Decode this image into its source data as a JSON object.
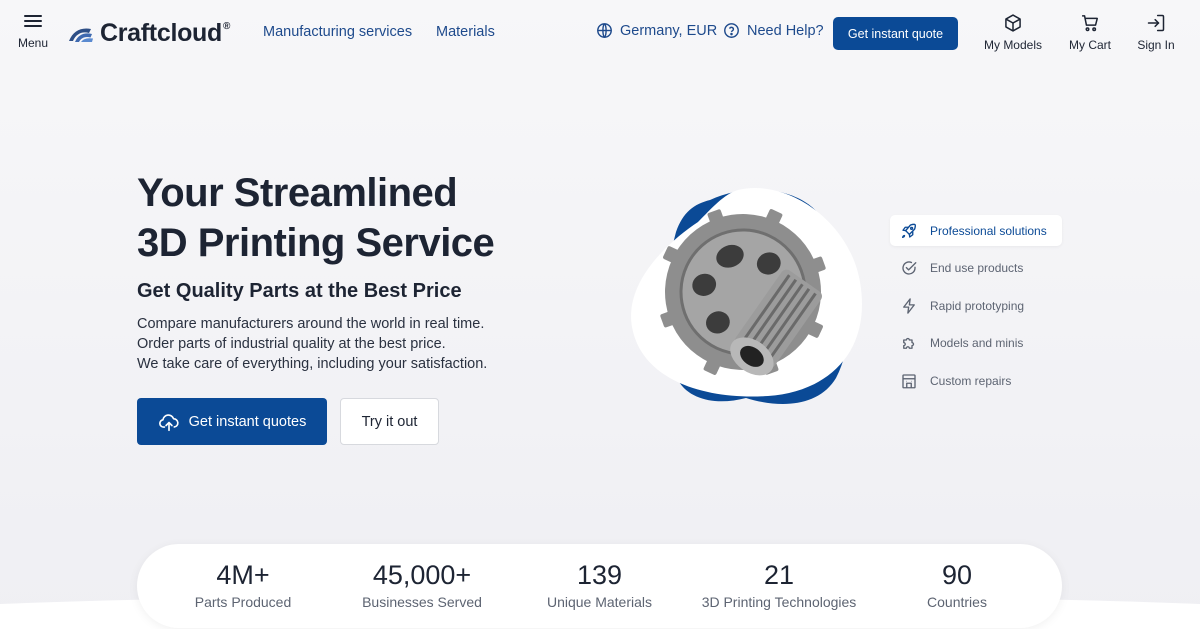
{
  "header": {
    "menu_label": "Menu",
    "logo_text": "Craftcloud",
    "logo_reg": "®",
    "nav": {
      "manufacturing": "Manufacturing services",
      "materials": "Materials"
    },
    "locale": "Germany, EUR",
    "help": "Need Help?",
    "quote_button": "Get instant quote",
    "my_models": "My Models",
    "my_cart": "My Cart",
    "sign_in": "Sign In"
  },
  "hero": {
    "title_line1": "Your Streamlined",
    "title_line2": "3D Printing Service",
    "subtitle": "Get Quality Parts at the Best Price",
    "desc_line1": "Compare manufacturers around the world in real time.",
    "desc_line2": "Order parts of industrial quality at the best price.",
    "desc_line3": "We take care of everything, including your satisfaction.",
    "primary_button": "Get instant quotes",
    "secondary_button": "Try it out"
  },
  "features": [
    {
      "label": "Professional solutions",
      "icon": "rocket-icon",
      "active": true
    },
    {
      "label": "End use products",
      "icon": "check-circle-icon",
      "active": false
    },
    {
      "label": "Rapid prototyping",
      "icon": "lightning-icon",
      "active": false
    },
    {
      "label": "Models and minis",
      "icon": "puzzle-icon",
      "active": false
    },
    {
      "label": "Custom repairs",
      "icon": "building-icon",
      "active": false
    }
  ],
  "stats": [
    {
      "value": "4M+",
      "caption": "Parts Produced"
    },
    {
      "value": "45,000+",
      "caption": "Businesses Served"
    },
    {
      "value": "139",
      "caption": "Unique Materials"
    },
    {
      "value": "21",
      "caption": "3D Printing Technologies"
    },
    {
      "value": "90",
      "caption": "Countries"
    }
  ],
  "colors": {
    "brand": "#0b4a96",
    "text": "#1d2433",
    "link": "#1e4a8c",
    "muted": "#5d6472"
  }
}
